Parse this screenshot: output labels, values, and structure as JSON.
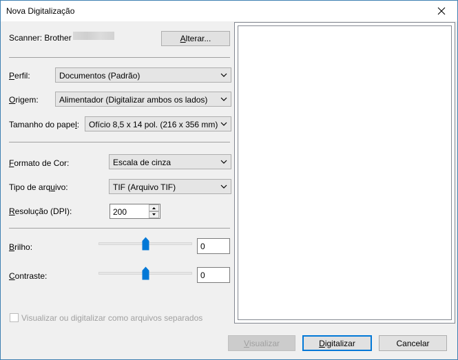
{
  "window": {
    "title": "Nova Digitalização",
    "close_glyph": "✕"
  },
  "scanner": {
    "label": "Scanner: Brother",
    "change_label_pre": "",
    "change_label_key": "A",
    "change_label_post": "lterar..."
  },
  "profile": {
    "label_key": "P",
    "label_post": "erfil:",
    "value": "Documentos (Padrão)"
  },
  "source": {
    "label_key": "O",
    "label_post": "rigem:",
    "value": "Alimentador (Digitalizar ambos os lados)"
  },
  "paper": {
    "label_pre": "Tamanho do pape",
    "label_key": "l",
    "label_post": ":",
    "value": "Ofício 8,5 x 14 pol. (216 x 356 mm)"
  },
  "color": {
    "label_key": "F",
    "label_post": "ormato de Cor:",
    "value": "Escala de cinza"
  },
  "filetype": {
    "label_pre": "Tipo de arq",
    "label_key": "u",
    "label_post": "ivo:",
    "value": "TIF (Arquivo TIF)"
  },
  "resolution": {
    "label_key": "R",
    "label_post": "esolução (DPI):",
    "value": "200"
  },
  "brightness": {
    "label_key": "B",
    "label_post": "rilho:",
    "value": "0",
    "level_fraction": 0.5
  },
  "contrast": {
    "label_key": "C",
    "label_post": "ontraste:",
    "value": "0",
    "level_fraction": 0.5
  },
  "separate": {
    "label_pre": "Visualizar ou di",
    "label_key": "g",
    "label_post": "italizar como arquivos separados",
    "checked": false
  },
  "buttons": {
    "preview_key": "V",
    "preview_post": "isualizar",
    "scan_key": "D",
    "scan_post": "igitalizar",
    "cancel": "Cancelar"
  },
  "colors": {
    "accent": "#0078d7",
    "slider_thumb": "#0078d7"
  }
}
